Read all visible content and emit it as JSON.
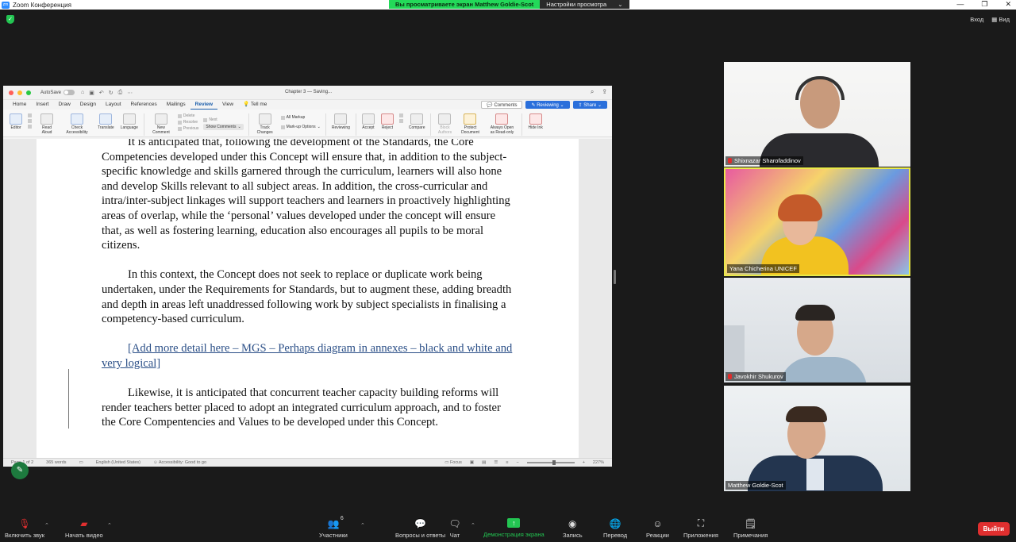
{
  "window": {
    "title": "Zoom Конференция",
    "app_icon": "zoom-icon"
  },
  "share_banner": {
    "viewing_text": "Вы просматриваете экран Matthew Goldie-Scot",
    "view_settings": "Настройки просмотра",
    "view_settings_caret": "⌄"
  },
  "top_right": {
    "enter": "Вход",
    "view": "Вид"
  },
  "word": {
    "autosave_label": "AutoSave",
    "document_title": "Chapter 3 — Saving...",
    "tabs": [
      "Home",
      "Insert",
      "Draw",
      "Design",
      "Layout",
      "References",
      "Mailings",
      "Review",
      "View",
      "Tell me"
    ],
    "active_tab": "Review",
    "comments_button": "Comments",
    "reviewing_button": "Reviewing",
    "share_button": "Share",
    "ribbon": {
      "editor": "Editor",
      "read_aloud": "Read Aloud",
      "check_accessibility": "Check Accessibility",
      "translate": "Translate",
      "language": "Language",
      "new_comment": "New Comment",
      "delete": "Delete",
      "resolve": "Resolve",
      "previous": "Previous",
      "next": "Next",
      "show_comments": "Show Comments",
      "track_changes": "Track Changes",
      "all_markup": "All Markup",
      "markup_options": "Mark-up Options",
      "reviewing": "Reviewing",
      "accept": "Accept",
      "reject": "Reject",
      "compare": "Compare",
      "block_authors": "Block Authors",
      "protect_document": "Protect Document",
      "always_open_read_only": "Always Open as Read-only",
      "hide_ink": "Hide Ink"
    },
    "paragraphs": [
      "It is anticipated that, following the development of the Standards, the Core Competencies developed under this Concept will ensure that, in addition to the subject-specific knowledge and skills garnered through the curriculum, learners will also hone and develop Skills relevant to all subject areas.  In addition, the cross-curricular and intra/inter-subject linkages will support teachers and learners in proactively highlighting areas of overlap, while the ‘personal’ values developed under the concept will ensure that, as well as fostering learning, education also encourages all pupils to be moral citizens.",
      "In this context, the Concept does not seek to replace or duplicate work being undertaken, under the Requirements for Standards, but to augment these, adding breadth and depth in areas left unaddressed following work by subject specialists in finalising a competency-based curriculum.",
      "[Add more detail here – MGS – Perhaps diagram in annexes – black and white and very logical]",
      "Likewise, it is anticipated that concurrent teacher capacity building reforms will render teachers better placed to adopt an integrated curriculum approach, and to foster the Core Compentencies and Values to be developed under this Concept."
    ],
    "status": {
      "page": "Page 1 of 2",
      "words": "365 words",
      "language": "English (United States)",
      "accessibility": "Accessibility: Good to go",
      "focus": "Focus",
      "zoom": "227%"
    }
  },
  "participants": [
    {
      "name": "Shixnazar Sharofaddinov",
      "muted": true
    },
    {
      "name": "Yana Chicherina UNICEF",
      "muted": false,
      "active": true
    },
    {
      "name": "Javokhir Shukurov",
      "muted": true
    },
    {
      "name": "Matthew Goldie-Scot",
      "muted": false
    }
  ],
  "toolbar": {
    "unmute": "Включить звук",
    "start_video": "Начать видео",
    "participants": "Участники",
    "participants_count": "6",
    "qa": "Вопросы и ответы",
    "chat": "Чат",
    "share_screen": "Демонстрация экрана",
    "record": "Запись",
    "translate": "Перевод",
    "reactions": "Реакции",
    "apps": "Приложения",
    "notes": "Примечания",
    "leave": "Выйти"
  },
  "colors": {
    "zoom_blue": "#2d8cff",
    "share_green": "#23d959",
    "leave_red": "#e02f2f",
    "active_speaker": "#e9e94a",
    "word_blue": "#1a5dab"
  }
}
